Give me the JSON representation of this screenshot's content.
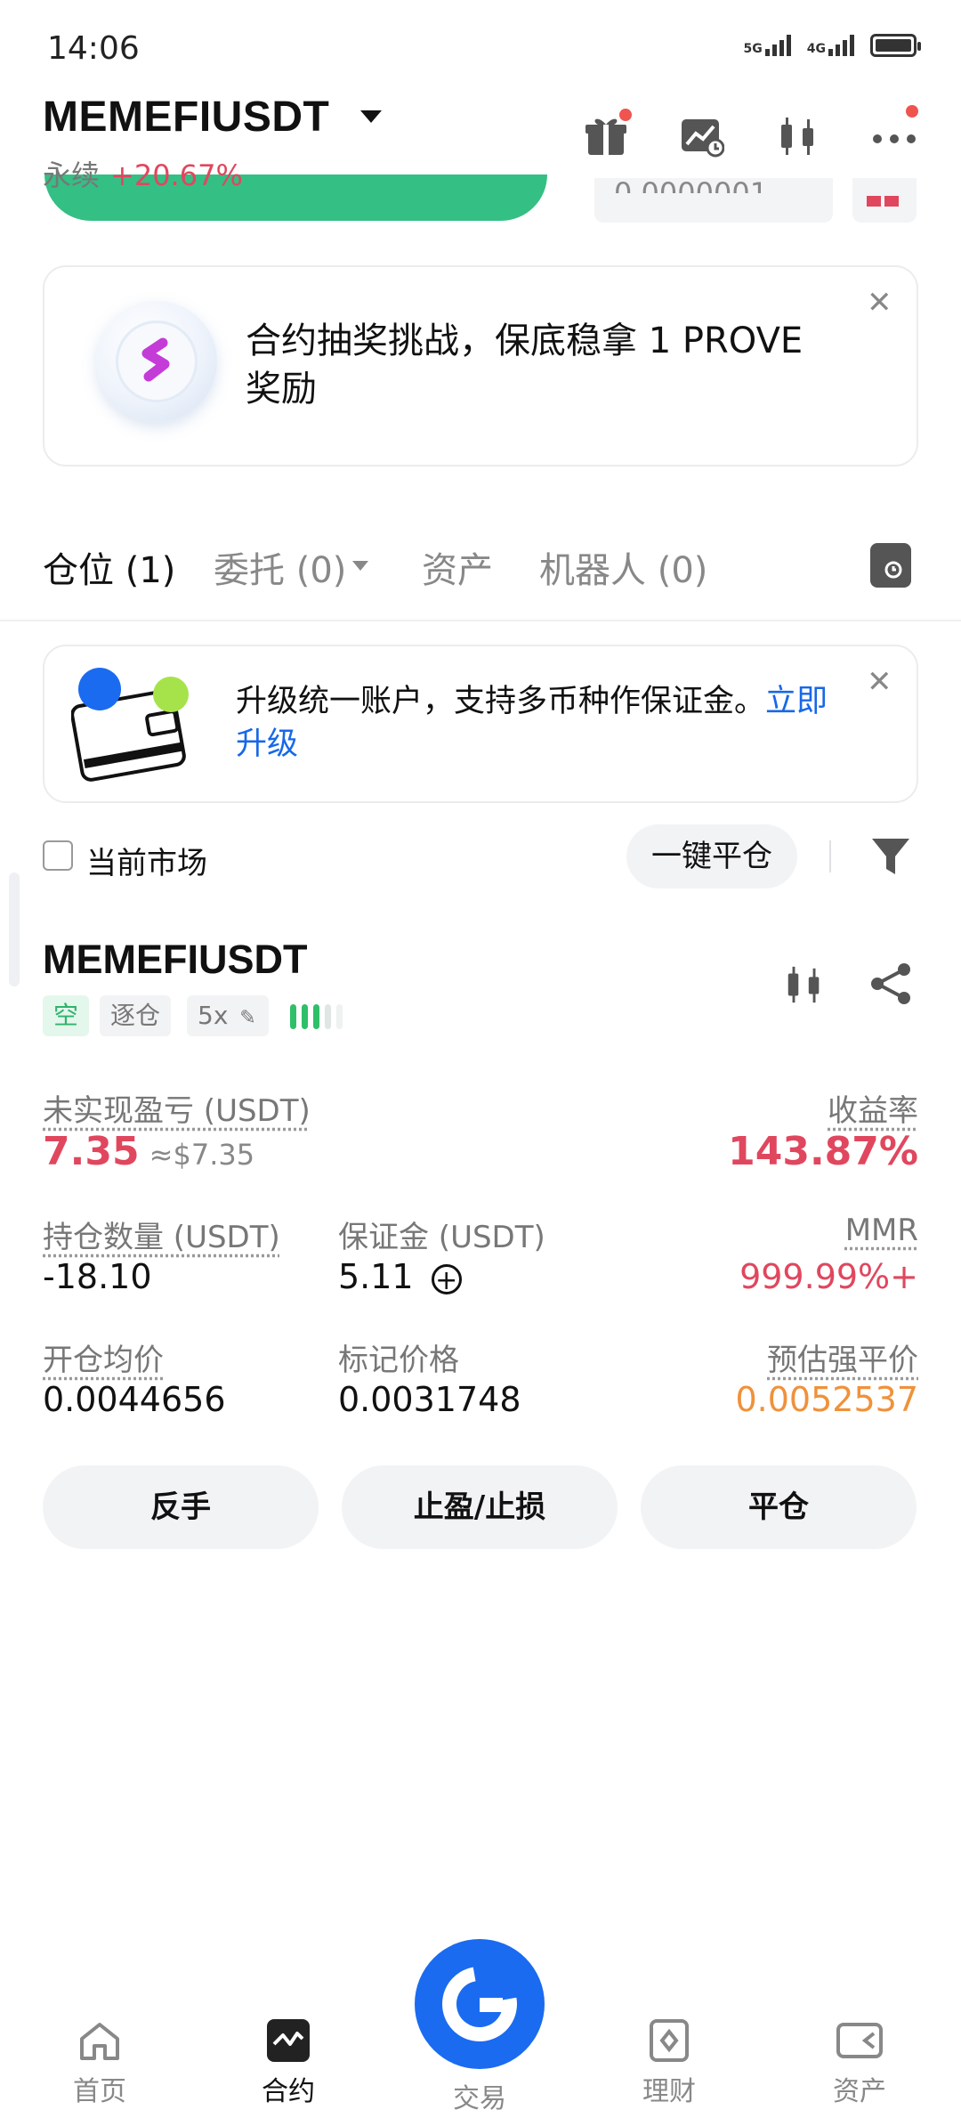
{
  "status_bar": {
    "time": "14:06",
    "signal1": "5G",
    "signal2": "4G"
  },
  "header": {
    "symbol": "MEMEFIUSDT",
    "type": "永续",
    "change": "+20.67%"
  },
  "ghost_value": "0.0000001",
  "promo_banner": {
    "text": "合约抽奖挑战，保底稳拿 1 PROVE 奖励"
  },
  "tabs": [
    {
      "label": "仓位 (1)"
    },
    {
      "label": "委托 (0)"
    },
    {
      "label": "资产"
    },
    {
      "label": "机器人 (0)"
    }
  ],
  "upgrade_banner": {
    "text": "升级统一账户，支持多币种作保证金。",
    "link": "立即升级"
  },
  "filter": {
    "current_market": "当前市场",
    "close_all": "一键平仓"
  },
  "position": {
    "symbol": "MEMEFIUSDT",
    "side": "空",
    "margin_mode": "逐仓",
    "leverage": "5x",
    "unrealized_pnl_label": "未实现盈亏 (USDT)",
    "unrealized_pnl": "7.35",
    "unrealized_pnl_usd": "≈$7.35",
    "roe_label": "收益率",
    "roe": "143.87%",
    "size_label": "持仓数量 (USDT)",
    "size": "-18.10",
    "margin_label": "保证金 (USDT)",
    "margin": "5.11",
    "mmr_label": "MMR",
    "mmr": "999.99%+",
    "entry_label": "开仓均价",
    "entry": "0.0044656",
    "mark_label": "标记价格",
    "mark": "0.0031748",
    "liq_label": "预估强平价",
    "liq": "0.0052537",
    "buttons": {
      "reverse": "反手",
      "tpsl": "止盈/止损",
      "close": "平仓"
    }
  },
  "nav": [
    {
      "label": "首页"
    },
    {
      "label": "合约"
    },
    {
      "label": "交易"
    },
    {
      "label": "理财"
    },
    {
      "label": "资产"
    }
  ],
  "colors": {
    "up_red": "#e0475e",
    "green": "#34bf84",
    "blue": "#1a6bf0",
    "orange": "#f0913a"
  }
}
